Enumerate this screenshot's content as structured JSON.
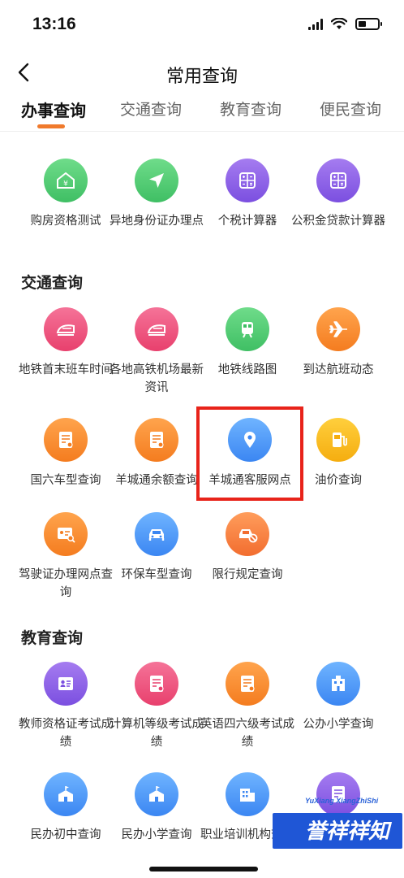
{
  "status_bar": {
    "time": "13:16"
  },
  "nav": {
    "title": "常用查询"
  },
  "tabs": [
    {
      "label": "办事查询",
      "active": true
    },
    {
      "label": "交通查询",
      "active": false
    },
    {
      "label": "教育查询",
      "active": false
    },
    {
      "label": "便民查询",
      "active": false
    }
  ],
  "sections": {
    "banshi": {
      "title": "",
      "items": [
        {
          "label": "购房资格测试",
          "icon": "house-icon",
          "color": "#4cc873"
        },
        {
          "label": "异地身份证办理点",
          "icon": "navigation-arrow-icon",
          "color": "#4cc873"
        },
        {
          "label": "个税计算器",
          "icon": "calculator-icon",
          "color": "#8a5cf0"
        },
        {
          "label": "公积金贷款计算器",
          "icon": "calculator-icon",
          "color": "#8a5cf0"
        }
      ]
    },
    "jiaotong": {
      "title": "交通查询",
      "items": [
        {
          "label": "地铁首末班车时间",
          "icon": "train-icon",
          "color": "#ee5580"
        },
        {
          "label": "各地高铁机场最新资讯",
          "icon": "train-icon",
          "color": "#ee5580"
        },
        {
          "label": "地铁线路图",
          "icon": "metro-icon",
          "color": "#4cc873"
        },
        {
          "label": "到达航班动态",
          "icon": "airplane-icon",
          "color": "#f58a2e"
        },
        {
          "label": "国六车型查询",
          "icon": "document-icon",
          "color": "#f58a2e"
        },
        {
          "label": "羊城通余额查询",
          "icon": "document-icon",
          "color": "#f58a2e"
        },
        {
          "label": "羊城通客服网点",
          "icon": "location-pin-icon",
          "color": "#4a95f5"
        },
        {
          "label": "油价查询",
          "icon": "fuel-icon",
          "color": "#f7b820"
        },
        {
          "label": "驾驶证办理网点查询",
          "icon": "id-card-search-icon",
          "color": "#f58a2e"
        },
        {
          "label": "环保车型查询",
          "icon": "car-icon",
          "color": "#4a95f5"
        },
        {
          "label": "限行规定查询",
          "icon": "car-restricted-icon",
          "color": "#f47a3a"
        }
      ]
    },
    "jiaoyu": {
      "title": "教育查询",
      "items": [
        {
          "label": "教师资格证考试成绩",
          "icon": "id-card-icon",
          "color": "#8a5cf0"
        },
        {
          "label": "计算机等级考试成绩",
          "icon": "document-icon",
          "color": "#ee5580"
        },
        {
          "label": "英语四六级考试成绩",
          "icon": "document-icon",
          "color": "#f58a2e"
        },
        {
          "label": "公办小学查询",
          "icon": "building-icon",
          "color": "#4a95f5"
        },
        {
          "label": "民办初中查询",
          "icon": "school-icon",
          "color": "#4a95f5"
        },
        {
          "label": "民办小学查询",
          "icon": "school-icon",
          "color": "#4a95f5"
        },
        {
          "label": "职业培训机构查询",
          "icon": "building-icon",
          "color": "#4a95f5"
        },
        {
          "label": "",
          "icon": "document-icon",
          "color": "#8a5cf0"
        }
      ]
    }
  },
  "watermark": {
    "small": "YuXiang XiangZhiShi",
    "main": "誉祥祥知识"
  },
  "highlight": {
    "target": "羊城通客服网点",
    "color": "#e8231a"
  }
}
